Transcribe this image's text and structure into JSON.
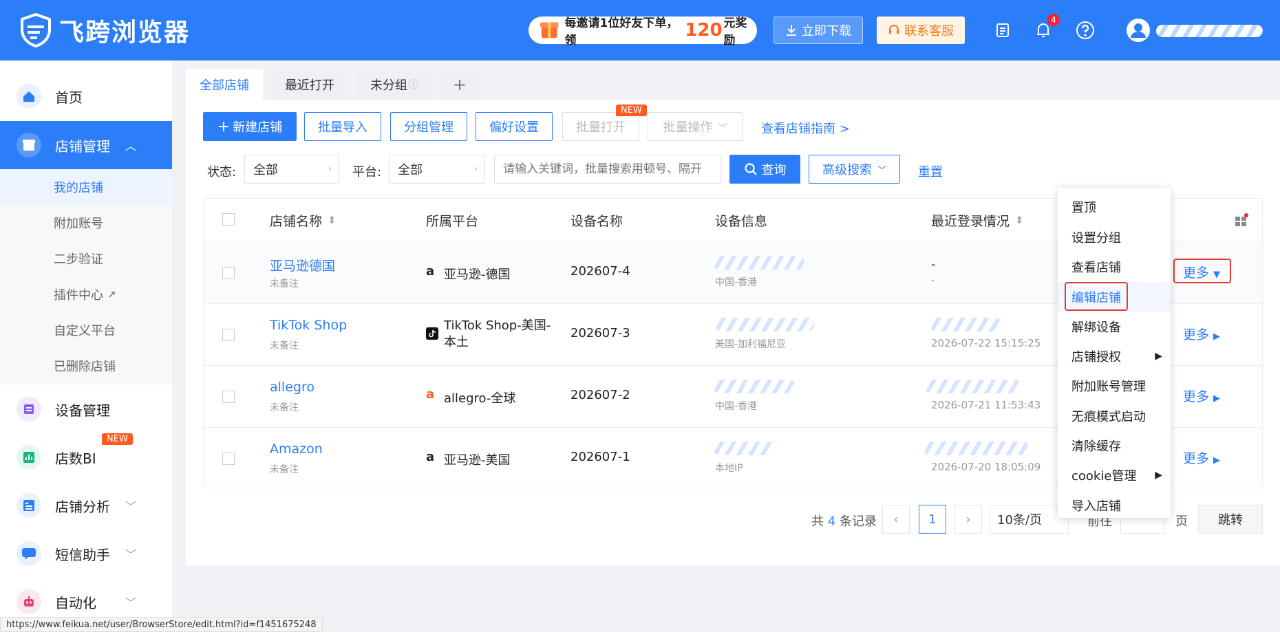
{
  "app": {
    "name": "飞跨浏览器"
  },
  "header": {
    "promo": {
      "prefix": "每邀请1位好友下单，领",
      "amount": "120",
      "suffix": "元奖励"
    },
    "download": "立即下载",
    "service": "联系客服",
    "notif_count": "4"
  },
  "sidebar": {
    "items": [
      {
        "label": "首页"
      },
      {
        "label": "店铺管理"
      },
      {
        "label": "设备管理"
      },
      {
        "label": "店数BI"
      },
      {
        "label": "店铺分析"
      },
      {
        "label": "短信助手"
      },
      {
        "label": "自动化"
      }
    ],
    "sub": [
      "我的店铺",
      "附加账号",
      "二步验证",
      "插件中心",
      "自定义平台",
      "已删除店铺"
    ],
    "new_tag": "NEW"
  },
  "tabs": [
    "全部店铺",
    "最近打开",
    "未分组",
    "+"
  ],
  "toolbar": {
    "create": "新建店铺",
    "import": "批量导入",
    "group": "分组管理",
    "pref": "偏好设置",
    "batch_open": "批量打开",
    "batch_ops": "批量操作",
    "guide": "查看店铺指南 >",
    "new_tag": "NEW"
  },
  "filters": {
    "status_label": "状态:",
    "status_value": "全部",
    "platform_label": "平台:",
    "platform_value": "全部",
    "search_placeholder": "请输入关键词，批量搜索用顿号、隔开",
    "query": "查询",
    "advanced": "高级搜索",
    "reset": "重置"
  },
  "table": {
    "headers": [
      "店铺名称",
      "所属平台",
      "设备名称",
      "设备信息",
      "最近登录情况"
    ],
    "rows": [
      {
        "name": "亚马逊德国",
        "note": "未备注",
        "platform": "亚马逊-德国",
        "device": "202607-4",
        "location": "中国-香港",
        "login": "-",
        "login_sub": "-",
        "more": "更多"
      },
      {
        "name": "TikTok Shop",
        "note": "未备注",
        "platform": "TikTok Shop-美国-本土",
        "device": "202607-3",
        "location": "美国-加利福尼亚",
        "login": "2026-07-22 15:15:25",
        "login_sub": "",
        "more": "更多"
      },
      {
        "name": "allegro",
        "note": "未备注",
        "platform": "allegro-全球",
        "device": "202607-2",
        "location": "中国-香港",
        "login": "2026-07-21 11:53:43",
        "login_sub": "",
        "more": "更多"
      },
      {
        "name": "Amazon",
        "note": "未备注",
        "platform": "亚马逊-美国",
        "device": "202607-1",
        "location": "本地IP",
        "login": "2026-07-20 18:05:09",
        "login_sub": "",
        "more": "更多"
      }
    ]
  },
  "menu": [
    "置顶",
    "设置分组",
    "查看店铺",
    "编辑店铺",
    "解绑设备",
    "店铺授权",
    "附加账号管理",
    "无痕模式启动",
    "清除缓存",
    "cookie管理",
    "导入店铺"
  ],
  "pager": {
    "total_prefix": "共",
    "total": "4",
    "total_suffix": "条记录",
    "page": "1",
    "size": "10条/页",
    "goto": "前往",
    "page_unit": "页",
    "jump": "跳转"
  },
  "statusbar": "https://www.feikua.net/user/BrowserStore/edit.html?id=f1451675248",
  "colors": {
    "primary": "#2c7ef8",
    "accent": "#ff5a1f",
    "highlight": "#e53935"
  }
}
